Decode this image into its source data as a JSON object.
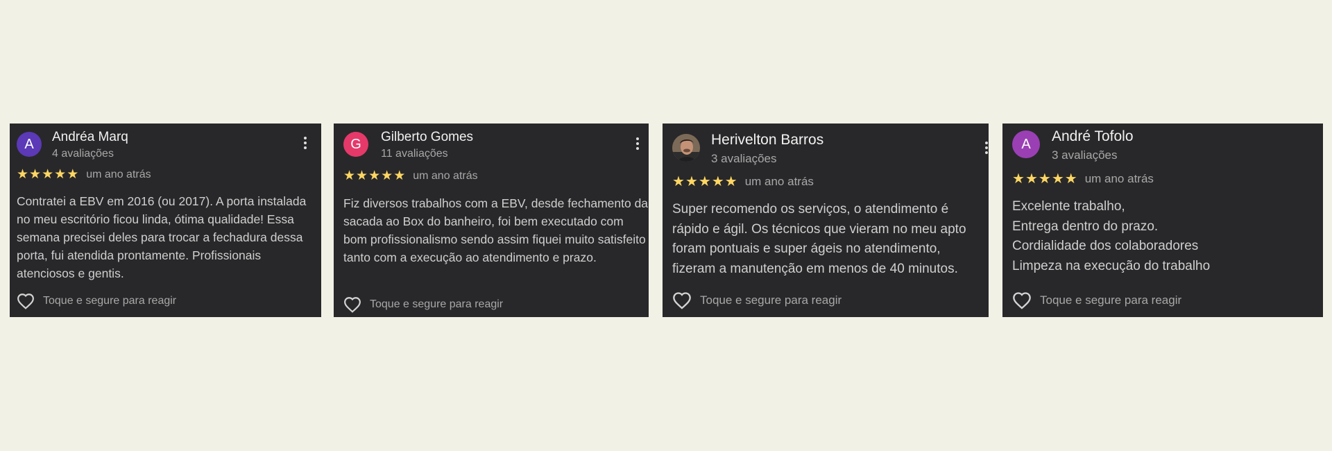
{
  "reviews": [
    {
      "author": "Andréa Marq",
      "avatar_letter": "A",
      "review_count": "4 avaliações",
      "rating": 5,
      "time": "um ano atrás",
      "text": "Contratei a EBV em 2016 (ou 2017). A porta instalada no meu escritório ficou linda, ótima qualidade! Essa semana precisei deles para trocar a fechadura dessa porta, fui atendida prontamente. Profissionais atenciosos e gentis.",
      "react_label": "Toque e segure para reagir"
    },
    {
      "author": "Gilberto Gomes",
      "avatar_letter": "G",
      "review_count": "11 avaliações",
      "rating": 5,
      "time": "um ano atrás",
      "text": "Fiz diversos trabalhos com a EBV, desde fechamento da sacada ao Box do banheiro, foi bem executado com bom profissionalismo sendo assim fiquei muito satisfeito tanto com a execução ao atendimento e prazo.",
      "react_label": "Toque e segure para reagir"
    },
    {
      "author": "Herivelton Barros",
      "avatar_letter": "",
      "review_count": "3 avaliações",
      "rating": 5,
      "time": "um ano atrás",
      "text": "Super recomendo os serviços, o atendimento é rápido e ágil. Os técnicos que vieram no meu apto foram pontuais e super ágeis no atendimento, fizeram a manutenção em menos de 40 minutos.",
      "react_label": "Toque e segure para reagir"
    },
    {
      "author": "André Tofolo",
      "avatar_letter": "A",
      "review_count": "3 avaliações",
      "rating": 5,
      "time": "um ano atrás",
      "text_lines": [
        "Excelente trabalho,",
        "Entrega dentro do prazo.",
        "Cordialidade dos colaboradores",
        "Limpeza na execução do trabalho"
      ],
      "react_label": "Toque e segure para reagir"
    }
  ],
  "colors": {
    "page_background": "#f2f1e6",
    "card_background": "#28282a",
    "star": "#fdd663",
    "avatar_andrea": "#5b39b7",
    "avatar_gilberto": "#e5396a",
    "avatar_andre": "#9b3fb5"
  },
  "icons": {
    "stars": "star-icon",
    "menu": "more-vert-icon",
    "react": "heart-outline-icon"
  }
}
